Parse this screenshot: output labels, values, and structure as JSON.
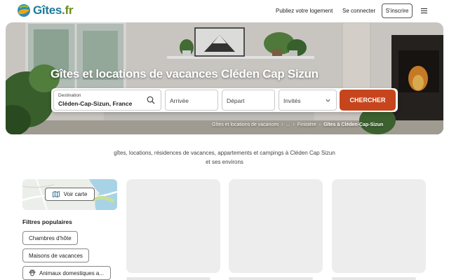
{
  "header": {
    "logo_text": "Gîtes",
    "logo_tld": ".fr",
    "publish_label": "Publiez votre logement",
    "login_label": "Se connecter",
    "signup_label": "S'inscrire"
  },
  "hero": {
    "title": "Gîtes et locations de vacances Cléden Cap Sizun"
  },
  "search": {
    "destination_label": "Destination",
    "destination_value": "Cléden-Cap-Sizun, France",
    "arrival_placeholder": "Arrivée",
    "departure_placeholder": "Départ",
    "guests_placeholder": "Invités",
    "submit_label": "CHERCHER"
  },
  "breadcrumb": {
    "items": [
      "Gîtes et locations de vacances",
      "...",
      "Finistère"
    ],
    "current": "Gîtes à Cléden-Cap-Sizun",
    "separator": "›"
  },
  "intro": {
    "line1": "gîtes, locations, résidences de vacances, appartements et campings à Cléden Cap Sizun",
    "line2": "et ses environs"
  },
  "sidebar": {
    "map_button_label": "Voir carte",
    "filters_title": "Filtres populaires",
    "filters": [
      "Chambres d'hôte",
      "Maisons de vacances",
      "Animaux domestiques a..."
    ]
  },
  "colors": {
    "accent": "#c7451d",
    "brand": "#1d7a9a",
    "brand_secondary": "#6b8c1e"
  }
}
